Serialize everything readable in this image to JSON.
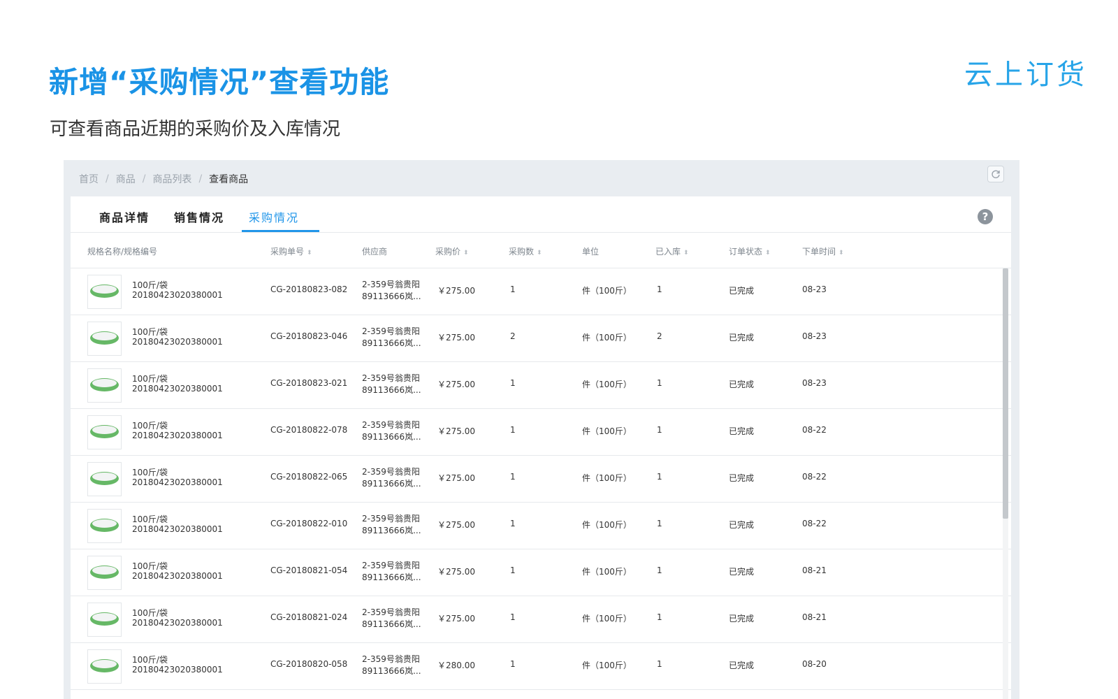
{
  "hero": {
    "title": "新增“采购情况”查看功能",
    "subtitle": "可查看商品近期的采购价及入库情况",
    "brand": "云上订货"
  },
  "breadcrumb": [
    "首页",
    "商品",
    "商品列表",
    "查看商品"
  ],
  "breadcrumb_separator": "/",
  "icons": {
    "refresh": "refresh-icon",
    "help": "help-icon",
    "sort": "sort-icon",
    "product": "product-thumbnail"
  },
  "tabs": [
    {
      "label": "商品详情",
      "active": false
    },
    {
      "label": "销售情况",
      "active": false
    },
    {
      "label": "采购情况",
      "active": true
    }
  ],
  "help_glyph": "?",
  "colors": {
    "accent": "#2196e9",
    "title": "#1a93e6",
    "frame_bg": "#e9edf1"
  },
  "table": {
    "columns": [
      {
        "label": "规格名称/规格编号",
        "sortable": false
      },
      {
        "label": "采购单号",
        "sortable": true
      },
      {
        "label": "供应商",
        "sortable": false
      },
      {
        "label": "采购价",
        "sortable": true
      },
      {
        "label": "采购数",
        "sortable": true
      },
      {
        "label": "单位",
        "sortable": false
      },
      {
        "label": "已入库",
        "sortable": true
      },
      {
        "label": "订单状态",
        "sortable": true
      },
      {
        "label": "下单时间",
        "sortable": true
      }
    ],
    "sort_glyph": "⬍",
    "rows": [
      {
        "spec_name": "100斤/袋",
        "spec_code": "20180423020380001",
        "order_no": "CG-20180823-082",
        "supplier_line1": "2-359号翁贵阳",
        "supplier_line2": "89113666岚...",
        "price": "￥275.00",
        "qty": "1",
        "unit": "件（100斤）",
        "stocked": "1",
        "status": "已完成",
        "date": "08-23"
      },
      {
        "spec_name": "100斤/袋",
        "spec_code": "20180423020380001",
        "order_no": "CG-20180823-046",
        "supplier_line1": "2-359号翁贵阳",
        "supplier_line2": "89113666岚...",
        "price": "￥275.00",
        "qty": "2",
        "unit": "件（100斤）",
        "stocked": "2",
        "status": "已完成",
        "date": "08-23"
      },
      {
        "spec_name": "100斤/袋",
        "spec_code": "20180423020380001",
        "order_no": "CG-20180823-021",
        "supplier_line1": "2-359号翁贵阳",
        "supplier_line2": "89113666岚...",
        "price": "￥275.00",
        "qty": "1",
        "unit": "件（100斤）",
        "stocked": "1",
        "status": "已完成",
        "date": "08-23"
      },
      {
        "spec_name": "100斤/袋",
        "spec_code": "20180423020380001",
        "order_no": "CG-20180822-078",
        "supplier_line1": "2-359号翁贵阳",
        "supplier_line2": "89113666岚...",
        "price": "￥275.00",
        "qty": "1",
        "unit": "件（100斤）",
        "stocked": "1",
        "status": "已完成",
        "date": "08-22"
      },
      {
        "spec_name": "100斤/袋",
        "spec_code": "20180423020380001",
        "order_no": "CG-20180822-065",
        "supplier_line1": "2-359号翁贵阳",
        "supplier_line2": "89113666岚...",
        "price": "￥275.00",
        "qty": "1",
        "unit": "件（100斤）",
        "stocked": "1",
        "status": "已完成",
        "date": "08-22"
      },
      {
        "spec_name": "100斤/袋",
        "spec_code": "20180423020380001",
        "order_no": "CG-20180822-010",
        "supplier_line1": "2-359号翁贵阳",
        "supplier_line2": "89113666岚...",
        "price": "￥275.00",
        "qty": "1",
        "unit": "件（100斤）",
        "stocked": "1",
        "status": "已完成",
        "date": "08-22"
      },
      {
        "spec_name": "100斤/袋",
        "spec_code": "20180423020380001",
        "order_no": "CG-20180821-054",
        "supplier_line1": "2-359号翁贵阳",
        "supplier_line2": "89113666岚...",
        "price": "￥275.00",
        "qty": "1",
        "unit": "件（100斤）",
        "stocked": "1",
        "status": "已完成",
        "date": "08-21"
      },
      {
        "spec_name": "100斤/袋",
        "spec_code": "20180423020380001",
        "order_no": "CG-20180821-024",
        "supplier_line1": "2-359号翁贵阳",
        "supplier_line2": "89113666岚...",
        "price": "￥275.00",
        "qty": "1",
        "unit": "件（100斤）",
        "stocked": "1",
        "status": "已完成",
        "date": "08-21"
      },
      {
        "spec_name": "100斤/袋",
        "spec_code": "20180423020380001",
        "order_no": "CG-20180820-058",
        "supplier_line1": "2-359号翁贵阳",
        "supplier_line2": "89113666岚...",
        "price": "￥280.00",
        "qty": "1",
        "unit": "件（100斤）",
        "stocked": "1",
        "status": "已完成",
        "date": "08-20"
      }
    ]
  }
}
